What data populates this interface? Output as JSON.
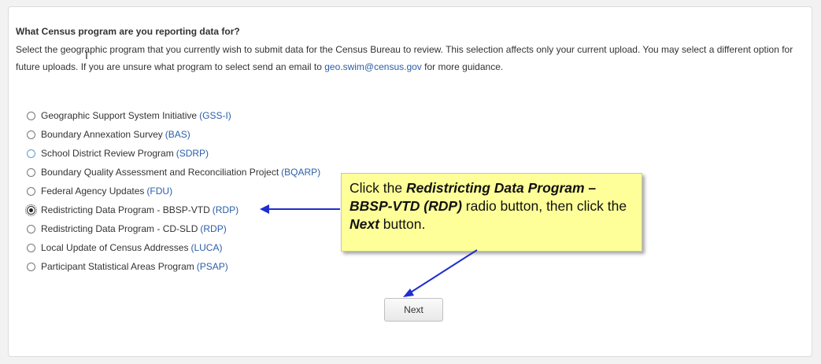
{
  "question": "What Census program are you reporting data for?",
  "description": {
    "text1": "Select the geographic program that you currently wish to submit data for the Census Bureau to review. This selection affects only your current upload. You may select a different option for future uploads. If you are unsure what program to select send an email to ",
    "email": "geo.swim@census.gov",
    "text2": " for more guidance."
  },
  "options": [
    {
      "label": "Geographic Support System Initiative",
      "abbr": "(GSS-I)",
      "checked": false
    },
    {
      "label": "Boundary Annexation Survey",
      "abbr": "(BAS)",
      "checked": false
    },
    {
      "label": "School District Review Program",
      "abbr": "(SDRP)",
      "checked": false
    },
    {
      "label": "Boundary Quality Assessment and Reconciliation Project",
      "abbr": "(BQARP)",
      "checked": false
    },
    {
      "label": "Federal Agency Updates",
      "abbr": "(FDU)",
      "checked": false
    },
    {
      "label": "Redistricting Data Program - BBSP-VTD",
      "abbr": "(RDP)",
      "checked": true
    },
    {
      "label": "Redistricting Data Program - CD-SLD",
      "abbr": "(RDP)",
      "checked": false
    },
    {
      "label": "Local Update of Census Addresses",
      "abbr": "(LUCA)",
      "checked": false
    },
    {
      "label": "Participant Statistical Areas Program",
      "abbr": "(PSAP)",
      "checked": false
    }
  ],
  "callout": {
    "part1": "Click the ",
    "bold1": "Redistricting Data Program – BBSP-VTD (RDP)",
    "part2": " radio button, then click the ",
    "bold2": "Next",
    "part3": " button."
  },
  "next_label": "Next",
  "colors": {
    "link": "#2b5ea8",
    "callout_bg": "#ffff99",
    "arrow": "#1f2fcf"
  }
}
